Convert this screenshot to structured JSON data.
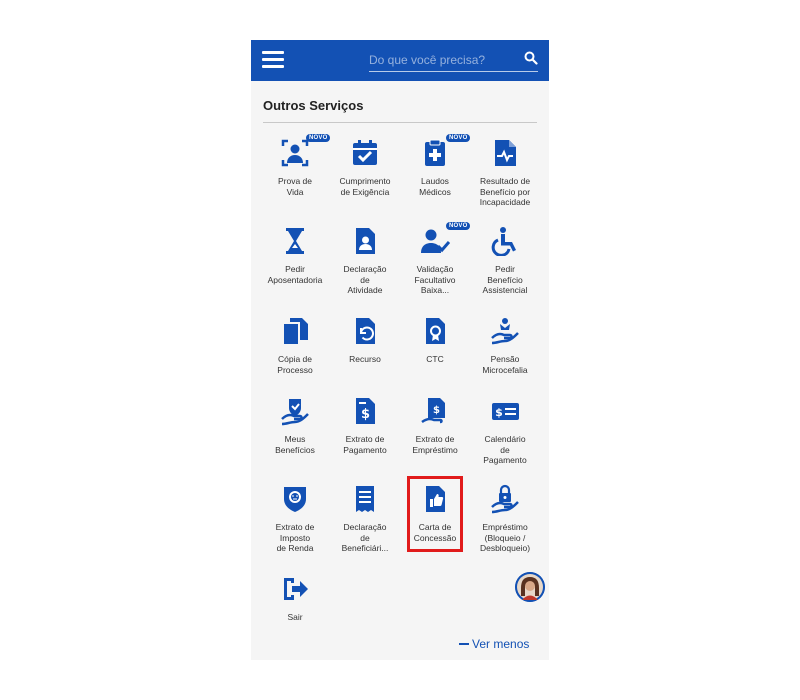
{
  "header": {
    "search_placeholder": "Do que você precisa?"
  },
  "section": {
    "title": "Outros Serviços"
  },
  "tiles": [
    {
      "label": "Prova de\nVida",
      "icon": "face-scan-icon",
      "badge": "NOVO"
    },
    {
      "label": "Cumprimento\nde Exigência",
      "icon": "calendar-check-icon"
    },
    {
      "label": "Laudos\nMédicos",
      "icon": "medical-clipboard-icon",
      "badge": "NOVO"
    },
    {
      "label": "Resultado de\nBenefício por\nIncapacidade",
      "icon": "document-pulse-icon"
    },
    {
      "label": "Pedir\nAposentadoria",
      "icon": "hourglass-icon"
    },
    {
      "label": "Declaração\nde\nAtividade",
      "icon": "document-person-icon"
    },
    {
      "label": "Validação\nFacultativo\nBaixa...",
      "icon": "user-check-icon",
      "badge": "NOVO"
    },
    {
      "label": "Pedir\nBenefício\nAssistencial",
      "icon": "wheelchair-icon"
    },
    {
      "label": "Cópia de\nProcesso",
      "icon": "copy-documents-icon"
    },
    {
      "label": "Recurso",
      "icon": "document-undo-icon"
    },
    {
      "label": "CTC",
      "icon": "document-certificate-icon"
    },
    {
      "label": "Pensão\nMicrocefalia",
      "icon": "hand-child-icon"
    },
    {
      "label": "Meus\nBenefícios",
      "icon": "hand-shield-icon"
    },
    {
      "label": "Extrato de\nPagamento",
      "icon": "document-dollar-icon"
    },
    {
      "label": "Extrato de\nEmpréstimo",
      "icon": "document-hand-dollar-icon"
    },
    {
      "label": "Calendário\nde\nPagamento",
      "icon": "money-card-icon"
    },
    {
      "label": "Extrato de\nImposto\nde Renda",
      "icon": "lion-shield-icon"
    },
    {
      "label": "Declaração\nde\nBeneficiári...",
      "icon": "receipt-icon"
    },
    {
      "label": "Carta de\nConcessão",
      "icon": "document-thumbsup-icon"
    },
    {
      "label": "Empréstimo\n(Bloqueio /\nDesbloqueio)",
      "icon": "hand-lock-icon"
    },
    {
      "label": "Sair",
      "icon": "exit-icon"
    }
  ],
  "footer": {
    "ver_menos": "Ver menos"
  },
  "colors": {
    "primary": "#1351b4",
    "highlight": "#e11b1b",
    "background": "#f5f5f5"
  }
}
